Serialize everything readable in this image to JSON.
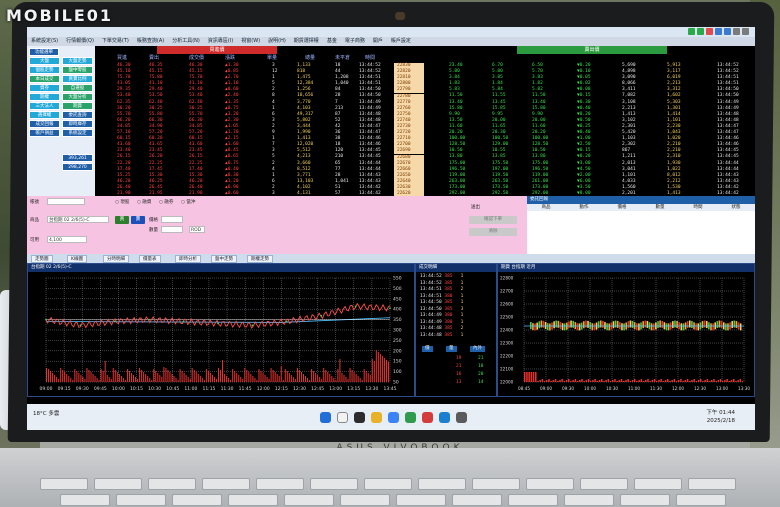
{
  "watermark": {
    "text": "MOBILE01"
  },
  "laptop": {
    "brand": "ASUS VIVOBOOK"
  },
  "app": {
    "title": "",
    "menu": [
      "系統設定(S)",
      "行情報價(Q)",
      "下單交易(T)",
      "帳務查詢(A)",
      "分析工具(N)",
      "資訊專區(I)",
      "視窗(W)",
      "說明(H)",
      "期貨選擇權",
      "基金",
      "電子商務",
      "開戶",
      "帳戶設定"
    ]
  },
  "left_panel": {
    "buttons": [
      "功能選單",
      "大盤",
      "大盤走勢",
      "個股走勢",
      "盤中零股",
      "本日成交",
      "買賣比例",
      "資券",
      "自選股",
      "期權",
      "大盤分析",
      "三大法人",
      "期貨",
      "選擇權",
      "委託查詢",
      "成交回報",
      "即時庫存",
      "帳戶損益",
      "系統設定"
    ],
    "value1": "393,261",
    "value2": "298,270"
  },
  "quote_left": {
    "header_tab": "買進價",
    "col_headers": [
      "買進",
      "賣出",
      "成交價",
      "漲跌",
      "單量",
      "總量",
      "未平倉",
      "時間"
    ],
    "c1": [
      "46.30",
      "45.10",
      "75.70",
      "41.05",
      "29.35",
      "53.40",
      "62.35",
      "30.20",
      "55.70",
      "66.20",
      "34.85",
      "57.10",
      "60.15",
      "43.60",
      "23.40",
      "26.15",
      "22.20",
      "17.40",
      "15.25",
      "46.20",
      "26.40",
      "21.90"
    ],
    "c2": [
      "46.35",
      "45.15",
      "75.80",
      "41.10",
      "29.40",
      "53.50",
      "62.40",
      "30.25",
      "55.80",
      "66.30",
      "34.90",
      "57.20",
      "60.20",
      "43.65",
      "23.45",
      "26.20",
      "22.25",
      "17.45",
      "15.30",
      "46.25",
      "26.45",
      "21.95"
    ],
    "c3": [
      "46.30",
      "45.15",
      "75.70",
      "41.10",
      "29.40",
      "53.40",
      "62.40",
      "30.25",
      "55.70",
      "66.30",
      "34.85",
      "57.20",
      "60.15",
      "43.60",
      "23.45",
      "26.15",
      "22.25",
      "17.40",
      "15.30",
      "46.20",
      "26.40",
      "21.90"
    ],
    "c4": [
      "▲1.30",
      "▲0.85",
      "▲2.70",
      "▲1.10",
      "▲0.60",
      "▲2.40",
      "▲1.35",
      "▲0.75",
      "▲3.20",
      "▲2.30",
      "▲1.05",
      "▲1.70",
      "▲2.15",
      "▲1.60",
      "▲0.45",
      "▲0.65",
      "▲0.75",
      "▲0.40",
      "▲0.30",
      "▲1.20",
      "▲0.90",
      "▲0.60"
    ],
    "c5": [
      "3",
      "12",
      "1",
      "5",
      "2",
      "8",
      "4",
      "1",
      "6",
      "3",
      "2",
      "9",
      "1",
      "7",
      "3",
      "5",
      "2",
      "4",
      "1",
      "6",
      "2",
      "3"
    ],
    "c6": [
      "1,133",
      "818",
      "1,475",
      "12,384",
      "1,256",
      "18,656",
      "3,770",
      "4,103",
      "49,317",
      "5,802",
      "3,444",
      "1,990",
      "1,413",
      "12,020",
      "5,512",
      "4,213",
      "3,660",
      "8,512",
      "3,771",
      "13,103",
      "4,102",
      "4,131"
    ],
    "c7": [
      "18",
      "44",
      "1,208",
      "1,040",
      "84",
      "28",
      "7",
      "213",
      "87",
      "52",
      "42",
      "36",
      "38",
      "18",
      "120",
      "210",
      "65",
      "77",
      "28",
      "1,041",
      "51",
      "57"
    ],
    "c8": [
      "13:44:52",
      "13:44:52",
      "13:44:51",
      "13:44:51",
      "13:44:50",
      "13:44:50",
      "13:44:49",
      "13:44:49",
      "13:44:48",
      "13:44:48",
      "13:44:47",
      "13:44:47",
      "13:44:46",
      "13:44:46",
      "13:44:45",
      "13:44:45",
      "13:44:44",
      "13:44:44",
      "13:44:43",
      "13:44:43",
      "13:44:42",
      "13:44:42"
    ]
  },
  "price_ladder": [
    "22830",
    "22820",
    "22810",
    "22800",
    "22790",
    "22780",
    "22770",
    "22760",
    "22750",
    "22740",
    "22730",
    "22720",
    "22710",
    "22700",
    "22690",
    "22680",
    "22670",
    "22660",
    "22650",
    "22640",
    "22630",
    "22620"
  ],
  "quote_right": {
    "header_tab": "賣出價",
    "c1": [
      "23.40",
      "5.80",
      "3.84",
      "1.83",
      "5.83",
      "11.50",
      "13.40",
      "15.80",
      "9.90",
      "13.50",
      "11.60",
      "20.20",
      "100.00",
      "128.50",
      "10.50",
      "13.80",
      "175.00",
      "196.50",
      "119.00",
      "263.00",
      "173.00",
      "292.00"
    ],
    "c2": [
      "6.70",
      "5.80",
      "3.85",
      "1.84",
      "5.84",
      "11.55",
      "13.45",
      "15.85",
      "9.95",
      "20.00",
      "11.65",
      "20.30",
      "100.50",
      "129.00",
      "10.55",
      "13.85",
      "175.50",
      "197.00",
      "119.50",
      "263.50",
      "173.50",
      "292.50"
    ],
    "c3": [
      "6.50",
      "5.70",
      "3.83",
      "1.82",
      "5.82",
      "11.50",
      "13.40",
      "15.80",
      "9.90",
      "20.00",
      "11.60",
      "20.20",
      "100.00",
      "128.50",
      "10.50",
      "13.80",
      "175.00",
      "196.50",
      "119.00",
      "261.00",
      "173.00",
      "292.00"
    ],
    "c4": [
      "▼0.20",
      "▼0.10",
      "▼0.05",
      "▼0.02",
      "▼0.08",
      "▼0.15",
      "▼0.30",
      "▼0.40",
      "▼0.20",
      "▼0.50",
      "▼0.25",
      "▼0.40",
      "▼1.00",
      "▼2.50",
      "▼0.15",
      "▼0.20",
      "▼3.00",
      "▼4.50",
      "▼2.00",
      "▼6.00",
      "▼3.50",
      "▼8.00"
    ],
    "c5": [
      "5,690",
      "4,898",
      "3,090",
      "8,066",
      "3,411",
      "7,082",
      "3,108",
      "2,213",
      "1,413",
      "3,102",
      "2,301",
      "5,420",
      "1,103",
      "2,302",
      "867",
      "1,211",
      "2,013",
      "3,041",
      "1,101",
      "4,033",
      "1,560",
      "2,201"
    ],
    "c6": [
      "5,913",
      "3,117",
      "6,019",
      "2,213",
      "3,312",
      "1,602",
      "5,303",
      "1,301",
      "1,414",
      "1,101",
      "2,230",
      "1,043",
      "1,020",
      "2,210",
      "2,210",
      "2,310",
      "1,930",
      "1,022",
      "8,012",
      "2,212",
      "1,530",
      "1,413"
    ],
    "c7": [
      "13:44:52",
      "13:44:52",
      "13:44:51",
      "13:44:51",
      "13:44:50",
      "13:44:50",
      "13:44:49",
      "13:44:49",
      "13:44:48",
      "13:44:48",
      "13:44:47",
      "13:44:47",
      "13:44:46",
      "13:44:46",
      "13:44:45",
      "13:44:45",
      "13:44:44",
      "13:44:44",
      "13:44:43",
      "13:44:43",
      "13:44:42",
      "13:44:42"
    ]
  },
  "order_panel": {
    "account_label": "帳號",
    "account_value": "",
    "type_options": [
      "現股",
      "融資",
      "融券",
      "當沖"
    ],
    "buy_label": "買",
    "sell_label": "賣",
    "product_label": "商品",
    "product_value": "台指期 02 2/6(5)-C",
    "price_label": "價格",
    "qty_label": "數量",
    "qty_value": "4,100",
    "submit_label": "送出",
    "order_type": "ROD",
    "confirm_label": "確認下單",
    "clear_label": "清除"
  },
  "deals": {
    "title": "委託回報",
    "cols": [
      "商品",
      "動作",
      "價格",
      "數量",
      "時間",
      "狀態"
    ]
  },
  "chart_tabs": [
    "走勢圖",
    "K線圖",
    "分時明細",
    "價量表",
    "即時分析",
    "盤中走勢",
    "期權走勢"
  ],
  "chart1": {
    "head": "台指期 02 2/6(5)-C",
    "y_ticks": [
      "550",
      "500",
      "450",
      "400",
      "350",
      "300",
      "250",
      "200",
      "150",
      "100",
      "50"
    ],
    "x_ticks": [
      "09:00",
      "09:15",
      "09:30",
      "09:45",
      "10:00",
      "10:15",
      "10:30",
      "10:45",
      "11:00",
      "11:15",
      "11:30",
      "11:45",
      "12:00",
      "12:15",
      "12:30",
      "12:45",
      "13:00",
      "13:15",
      "13:30",
      "13:45"
    ]
  },
  "ticks_panel": {
    "head": "成交明細",
    "rows": [
      {
        "t": "13:44:52",
        "p": "385",
        "q": "1"
      },
      {
        "t": "13:44:52",
        "p": "385",
        "q": "1"
      },
      {
        "t": "13:44:51",
        "p": "385",
        "q": "2"
      },
      {
        "t": "13:44:51",
        "p": "380",
        "q": "1"
      },
      {
        "t": "13:44:50",
        "p": "385",
        "q": "1"
      },
      {
        "t": "13:44:50",
        "p": "385",
        "q": "3"
      },
      {
        "t": "13:44:49",
        "p": "380",
        "q": "1"
      },
      {
        "t": "13:44:49",
        "p": "380",
        "q": "1"
      },
      {
        "t": "13:44:48",
        "p": "385",
        "q": "2"
      },
      {
        "t": "13:44:48",
        "p": "385",
        "q": "1"
      }
    ],
    "bottom_head": [
      "價",
      "量",
      "內外"
    ],
    "bottom_rows": [
      {
        "p": "19",
        "q": "21"
      },
      {
        "p": "21",
        "q": "18"
      },
      {
        "p": "16",
        "q": "20"
      },
      {
        "p": "13",
        "q": "14"
      }
    ]
  },
  "chart2": {
    "head": "期貨 台指期 近月",
    "y_ticks": [
      "22800",
      "22700",
      "22600",
      "22500",
      "22400",
      "22300",
      "22200",
      "22100",
      "22000"
    ],
    "x_ticks": [
      "08:45",
      "09:00",
      "09:30",
      "10:00",
      "10:30",
      "11:00",
      "11:30",
      "12:00",
      "12:30",
      "13:00",
      "13:30"
    ]
  },
  "taskbar": {
    "weather": "18°C 多雲",
    "time": "下午 01:44",
    "date": "2025/2/18"
  },
  "chart_data": {
    "type": "line",
    "x": [
      "09:00",
      "09:30",
      "10:00",
      "10:30",
      "11:00",
      "11:30",
      "12:00",
      "12:30",
      "13:00",
      "13:30",
      "13:45"
    ],
    "series": [
      {
        "values": [
          330,
          300,
          320,
          330,
          320,
          310,
          300,
          320,
          350,
          400,
          390
        ]
      }
    ],
    "ylim": [
      0,
      550
    ]
  }
}
